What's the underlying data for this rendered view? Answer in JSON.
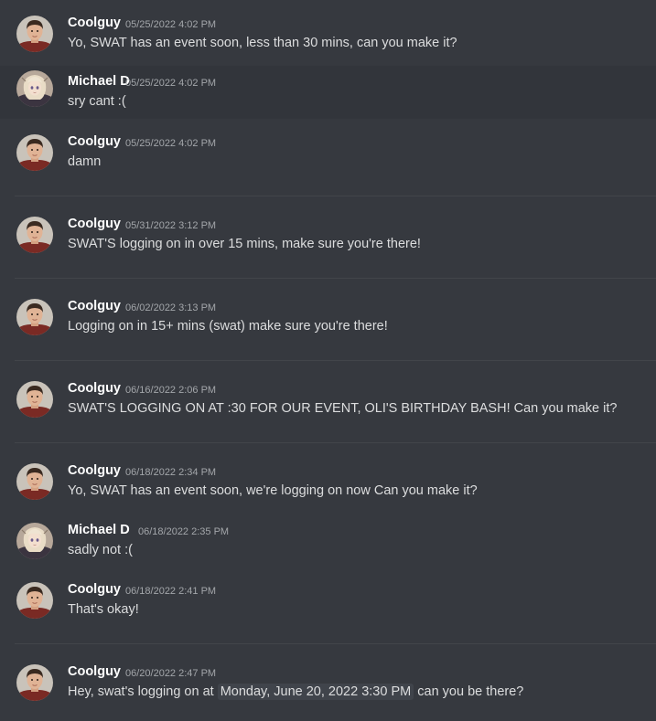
{
  "messages": [
    {
      "author": "Coolguy",
      "avatar": "coolguy-avatar",
      "timestamp": "05/25/2022 4:02 PM",
      "text": "Yo, SWAT has an event soon, less than 30 mins, can you make it?"
    },
    {
      "author": "Michael D",
      "avatar": "michael-avatar",
      "timestamp": "05/25/2022 4:02 PM",
      "text": "sry cant :("
    },
    {
      "author": "Coolguy",
      "avatar": "coolguy-avatar",
      "timestamp": "05/25/2022 4:02 PM",
      "text": "damn"
    },
    {
      "author": "Coolguy",
      "avatar": "coolguy-avatar",
      "timestamp": "05/31/2022 3:12 PM",
      "text": "SWAT'S logging on in over 15 mins, make sure you're there!"
    },
    {
      "author": "Coolguy",
      "avatar": "coolguy-avatar",
      "timestamp": "06/02/2022 3:13 PM",
      "text": "Logging on in 15+ mins (swat) make sure you're there!"
    },
    {
      "author": "Coolguy",
      "avatar": "coolguy-avatar",
      "timestamp": "06/16/2022 2:06 PM",
      "text": "SWAT'S LOGGING ON AT :30 FOR OUR EVENT, OLI'S BIRTHDAY BASH! Can you make it?"
    },
    {
      "author": "Coolguy",
      "avatar": "coolguy-avatar",
      "timestamp": "06/18/2022 2:34 PM",
      "text": "Yo, SWAT has an event soon, we're logging on now Can you make it?"
    },
    {
      "author": "Michael D",
      "avatar": "michael-avatar",
      "timestamp": "06/18/2022 2:35 PM",
      "text": "sadly not :("
    },
    {
      "author": "Coolguy",
      "avatar": "coolguy-avatar",
      "timestamp": "06/18/2022 2:41 PM",
      "text": "That's okay!"
    },
    {
      "author": "Coolguy",
      "avatar": "coolguy-avatar",
      "timestamp": "06/20/2022 2:47 PM",
      "text_before": "Hey, swat's logging on at",
      "mention": "Monday, June 20, 2022 3:30 PM",
      "text_after": "can you be there?"
    }
  ],
  "colors": {
    "background": "#36393f",
    "highlight_row": "#32353b",
    "author": "#ffffff",
    "timestamp": "#a3a6aa",
    "text": "#dcddde",
    "mention_bg": "#40444b"
  }
}
